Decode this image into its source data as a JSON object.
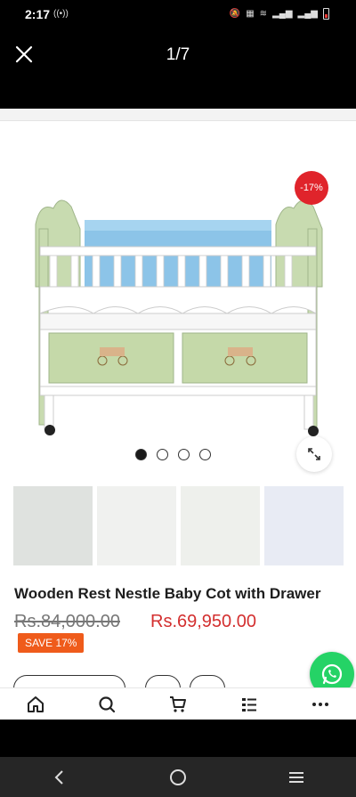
{
  "status_bar": {
    "time": "2:17",
    "icons": [
      "hotspot-icon",
      "mute-icon",
      "volte-icon",
      "wifi-icon",
      "signal-icon",
      "battery-icon"
    ]
  },
  "viewer": {
    "counter": "1/7"
  },
  "product": {
    "discount_badge": "-17%",
    "title": "Wooden Rest Nestle Baby Cot with Drawer",
    "old_price": "Rs.84,000.00",
    "new_price": "Rs.69,950.00",
    "save_label": "SAVE 17%",
    "carousel_dots": 4,
    "active_dot": 0
  },
  "bottom_nav": {
    "icons": [
      "home-icon",
      "search-icon",
      "cart-icon",
      "list-icon",
      "more-icon"
    ]
  },
  "colors": {
    "price_red": "#d32f2f",
    "save_orange": "#ef5b1b",
    "whatsapp_green": "#25d366",
    "discount_red": "#e0242b"
  }
}
